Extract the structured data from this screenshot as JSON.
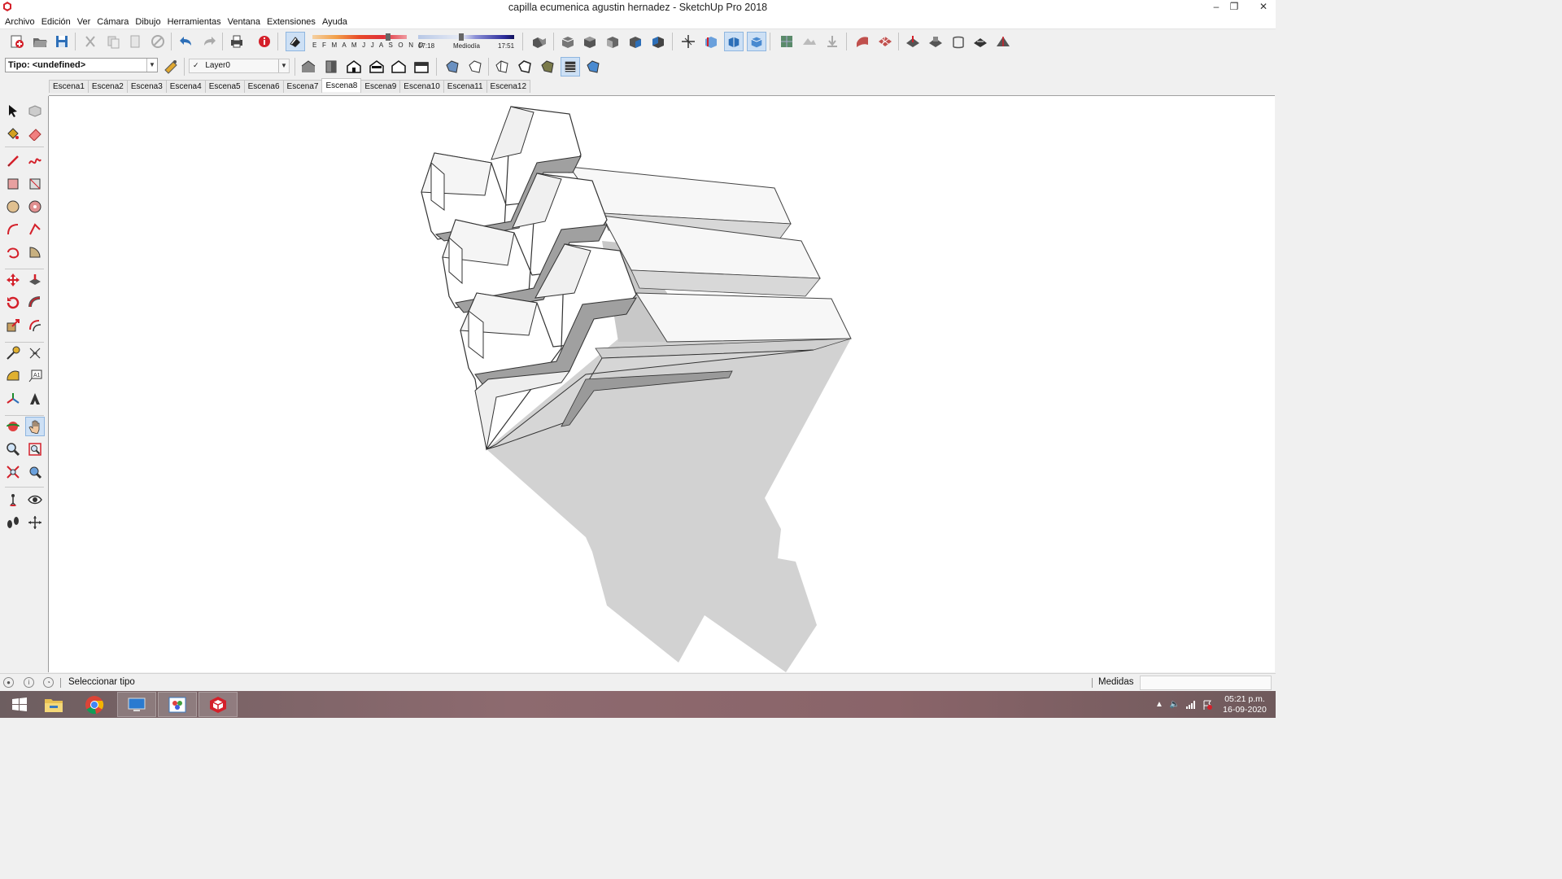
{
  "window": {
    "title": "capilla ecumenica agustin hernadez - SketchUp Pro 2018",
    "controls": {
      "minimize": "–",
      "restore": "❐",
      "close": "✕"
    }
  },
  "menu": [
    "Archivo",
    "Edición",
    "Ver",
    "Cámara",
    "Dibujo",
    "Herramientas",
    "Ventana",
    "Extensiones",
    "Ayuda"
  ],
  "toolbar": {
    "type_selector": "Tipo: <undefined>",
    "layer": "Layer0",
    "shadow_months": "E F M A M J J A S O N D",
    "shadow_time_start": "07:18",
    "shadow_time_mid": "Mediodía",
    "shadow_time_end": "17:51"
  },
  "scenes": {
    "tabs": [
      "Escena1",
      "Escena2",
      "Escena3",
      "Escena4",
      "Escena5",
      "Escena6",
      "Escena7",
      "Escena8",
      "Escena9",
      "Escena10",
      "Escena11",
      "Escena12"
    ],
    "active": "Escena8"
  },
  "status": {
    "text": "Seleccionar tipo",
    "measure_label": "Medidas",
    "measure_value": ""
  },
  "taskbar": {
    "time": "05:21 p.m.",
    "date": "16-09-2020"
  },
  "colors": {
    "accent": "#cde0f5",
    "sketchup_red": "#d4202a",
    "shadow_gray": "#cfcfcf"
  }
}
